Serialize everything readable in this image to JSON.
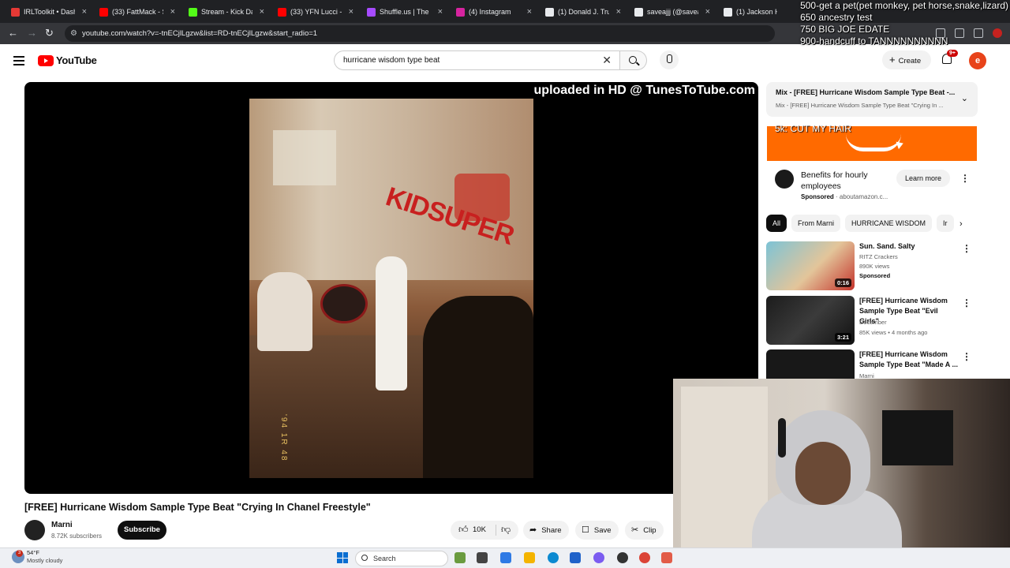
{
  "tabs": [
    {
      "title": "IRLToolkit • Dashb",
      "color": "#e53935"
    },
    {
      "title": "(33) FattMack - St",
      "color": "#ff0000"
    },
    {
      "title": "Stream - Kick Dash",
      "color": "#53fc18"
    },
    {
      "title": "(33) YFN Lucci - C",
      "color": "#ff0000"
    },
    {
      "title": "Shuffle.us | The #",
      "color": "#a64bff"
    },
    {
      "title": "(4) Instagram",
      "color": "#d6249f"
    },
    {
      "title": "(1) Donald J. Trum",
      "color": "#e8eaed"
    },
    {
      "title": "saveajjj (@saveajj",
      "color": "#e8eaed"
    },
    {
      "title": "(1) Jackson Hin",
      "color": "#e8eaed"
    }
  ],
  "address": {
    "url": "youtube.com/watch?v=-tnECjlLgzw&list=RD-tnECjlLgzw&start_radio=1"
  },
  "stream_overlay": [
    "500-get a pet(pet monkey, pet horse,snake,lizard)",
    "650 ancestry test",
    "750 BIG JOE EDATE",
    "900-handcuff to TANNNNNNNNNN"
  ],
  "youtube": {
    "logo_text": "YouTube",
    "search_query": "hurricane wisdom type beat",
    "create_label": "Create",
    "notification_badge": "9+",
    "avatar_letter": "e"
  },
  "player": {
    "watermark": "uploaded in HD @ TunesToTube.com",
    "wall_text": "KIDSUPER",
    "stamp": "'94 1R 48"
  },
  "video": {
    "title": "[FREE] Hurricane Wisdom Sample Type Beat \"Crying In Chanel Freestyle\"",
    "channel": "Marni",
    "subscribers": "8.72K subscribers",
    "subscribe_label": "Subscribe",
    "likes": "10K",
    "share_label": "Share",
    "save_label": "Save",
    "clip_label": "Clip"
  },
  "sidebar": {
    "playlist_line1": "Mix - [FREE] Hurricane Wisdom Sample Type Beat -...",
    "playlist_line2": "Mix - [FREE] Hurricane Wisdom Sample Type Beat \"Crying In ...",
    "ad_overlay": "5k: CUT MY HAIR",
    "ad_title": "Benefits for hourly employees",
    "ad_sponsor": "Sponsored",
    "ad_domain": "aboutamazon.c...",
    "ad_button": "Learn more",
    "chips": [
      "All",
      "From Marni",
      "HURRICANE WISDOM",
      "Ir"
    ],
    "recommendations": [
      {
        "title": "Sun. Sand. Salty",
        "channel": "RITZ Crackers",
        "meta": "890K views",
        "extra": "Sponsored",
        "duration": "0:16"
      },
      {
        "title": "[FREE] Hurricane Wisdom Sample Type Beat \"Evil Girls\"",
        "channel": "December",
        "meta": "85K views • 4 months ago",
        "extra": "",
        "duration": "3:21"
      },
      {
        "title": "[FREE] Hurricane Wisdom Sample Type Beat \"Made A ...",
        "channel": "Marni",
        "meta": "",
        "extra": "",
        "duration": ""
      }
    ]
  },
  "taskbar": {
    "weather_badge": "3",
    "temperature": "54°F",
    "condition": "Mostly cloudy",
    "search_label": "Search"
  }
}
